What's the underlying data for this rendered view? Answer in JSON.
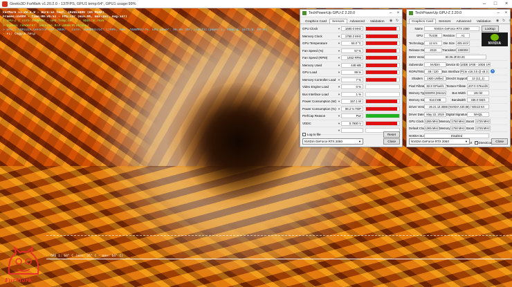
{
  "furmark": {
    "title": "Geeks3D FurMark v1.20.2.0 - 137FPS, GPU1 temp:64°, GPU1 usage:99%",
    "osd": {
      "line1": "FurMark v1.20.2.0 - Burn-in test, 1920x1080 (8X MSAA)",
      "line2": "Frames:15489 - time:00:26:51 - FPS:137 (min:96, max:151, avg:137)",
      "line3": "[ GPU-Z ] core:1680MHz - GPU temp:64° C - VDDC:0.793V",
      "line4": "> OpenGL renderer: GeForce RTX 2060/PCIe/SSE2",
      "line5": "> GPU 1 (NVIDIA GeForce RTX 2060) - core: 1680MHz/64° C/99%, mem: 7000MHz/7%, GPU power: 96.8% TDP, limits:[power:1, temp:0, volt:0, OV:0]",
      "line6": "- F1: toggle help"
    },
    "graph_label": "GPU 1: 64° C (min: 35° C - max: 64° C)",
    "logo_text": "FurMark",
    "colors": {
      "osd_gpu": "#9cff6a",
      "osd_gpu1": "#74d4ff",
      "logo": "#e6302a"
    }
  },
  "sensors_window": {
    "title": "TechPowerUp GPU-Z 2.20.0",
    "tabs": [
      "Graphics Card",
      "Sensors",
      "Advanced",
      "Validation"
    ],
    "active_tab": "Sensors",
    "rows": [
      {
        "name": "GPU Clock",
        "value": "1680.0 MHz",
        "fill": 0.92,
        "color": "#e01010"
      },
      {
        "name": "Memory Clock",
        "value": "1750.2 MHz",
        "fill": 0.95,
        "color": "#e01010"
      },
      {
        "name": "GPU Temperature",
        "value": "64.0 °C",
        "fill": 0.93,
        "color": "#e01010"
      },
      {
        "name": "Fan Speed (%)",
        "value": "57 %",
        "fill": 0.92,
        "color": "#e01010"
      },
      {
        "name": "Fan Speed (RPM)",
        "value": "1452 RPM",
        "fill": 0.93,
        "color": "#e01010"
      },
      {
        "name": "Memory Used",
        "value": "448 MB",
        "fill": 0.93,
        "color": "#e01010"
      },
      {
        "name": "GPU Load",
        "value": "99 %",
        "fill": 0.94,
        "color": "#e01010"
      },
      {
        "name": "Memory Controller Load",
        "value": "7 %",
        "fill": 0.92,
        "color": "#e01010"
      },
      {
        "name": "Video Engine Load",
        "value": "0 %",
        "fill": 0.0,
        "color": "#e01010"
      },
      {
        "name": "Bus Interface Load",
        "value": "1 %",
        "fill": 0.0,
        "color": "#e01010"
      },
      {
        "name": "Power Consumption (W)",
        "value": "157.1 W",
        "fill": 0.93,
        "color": "#e01010"
      },
      {
        "name": "Power Consumption (%)",
        "value": "98.2 % TDP",
        "fill": 0.93,
        "color": "#e01010"
      },
      {
        "name": "PerfCap Reason",
        "value": "Pwr",
        "fill": 1.0,
        "color": "#1fb31f"
      },
      {
        "name": "VDDC",
        "value": "0.7930 V",
        "fill": 0.93,
        "color": "#e01010"
      },
      {
        "name": "",
        "value": "",
        "fill": 0.0,
        "color": "#e01010"
      }
    ],
    "log_label": "Log to file",
    "reset_label": "Reset",
    "device": "NVIDIA GeForce RTX 2060",
    "close_label": "Close"
  },
  "card_window": {
    "title": "TechPowerUp GPU-Z 2.20.0",
    "tabs": [
      "Graphics Card",
      "Sensors",
      "Advanced",
      "Validation"
    ],
    "active_tab": "Graphics Card",
    "name_label": "Name",
    "name": "NVIDIA GeForce RTX 2060",
    "lookup_label": "Lookup",
    "gpu_label": "GPU",
    "gpu": "TU106",
    "revision_label": "Revision",
    "revision": "A1",
    "technology_label": "Technology",
    "technology": "12 nm",
    "die_size_label": "Die Size",
    "die_size": "445 mm²",
    "release_label": "Release Date",
    "release": "2019",
    "transistors_label": "Transistors",
    "transistors": "10800M",
    "bios_label": "BIOS Version",
    "bios": "90.06.3F.00.2C",
    "subvendor_label": "Subvendor",
    "subvendor": "NVIDIA",
    "device_id_label": "Device ID",
    "device_id": "10DE 1F08 - 10DE 1F08",
    "rops_label": "ROPs/TMUs",
    "rops": "48 / 120",
    "bus_label": "Bus Interface",
    "bus": "PCIe x16 3.0 @ x8 3.0",
    "shaders_label": "Shaders",
    "shaders": "1920 Unified",
    "directx_label": "DirectX Support",
    "directx": "12 (12_1)",
    "pixel_label": "Pixel Fillrate",
    "pixel": "82.8 GPixel/s",
    "texture_label": "Texture Fillrate",
    "texture": "207.0 GTexel/s",
    "memtype_label": "Memory Type",
    "memtype": "GDDR6 (Micron)",
    "buswidth_label": "Bus Width",
    "buswidth": "192 bit",
    "memsize_label": "Memory Size",
    "memsize": "6144 MB",
    "bandwidth_label": "Bandwidth",
    "bandwidth": "336.0 GB/s",
    "driver_label": "Driver Version",
    "driver": "26.21.14.3086 (NVIDIA 430.86) / Win10 64",
    "driverdate_label": "Driver Date",
    "driverdate": "May 22, 2019",
    "digsig_label": "Digital Signature",
    "digsig": "WHQL",
    "gpuclock_label": "GPU Clock",
    "gpuclock": "1365 MHz",
    "mem_label": "Memory",
    "mem": "1750 MHz",
    "boost_label": "Boost",
    "boost": "1725 MHz",
    "defclock_label": "Default Clock",
    "defclock": "1365 MHz",
    "defmem": "1750 MHz",
    "defboost": "1725 MHz",
    "sli_label": "NVIDIA SLI",
    "sli": "Disabled",
    "computing_label": "Computing",
    "computing": [
      "OpenCL",
      "CUDA",
      "PhysX",
      "DirectCompute 5.0"
    ],
    "device": "NVIDIA GeForce RTX 2060",
    "close_label": "Close",
    "logo_text": "NVIDIA"
  }
}
